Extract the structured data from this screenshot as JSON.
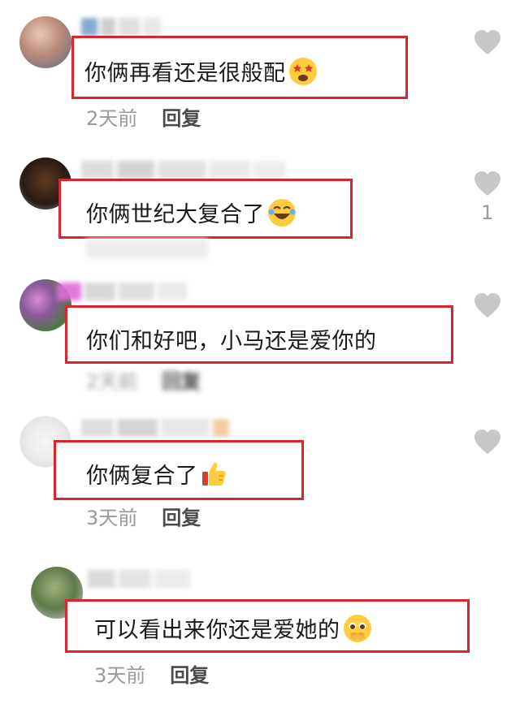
{
  "comments": [
    {
      "text": "你俩再看还是很般配",
      "emoji": "star-eyes-emoji",
      "time": "2天前",
      "reply": "回复",
      "likes": ""
    },
    {
      "text": "你俩世纪大复合了",
      "emoji": "laughing-tears-emoji",
      "time": "",
      "reply": "",
      "likes": "1"
    },
    {
      "text": "你们和好吧，小马还是爱你的",
      "emoji": "",
      "time": "2天前",
      "reply": "回复",
      "likes": ""
    },
    {
      "text": "你俩复合了",
      "emoji": "thumbs-up-emoji",
      "time": "3天前",
      "reply": "回复",
      "likes": ""
    },
    {
      "text": "可以看出来你还是爱她的",
      "emoji": "pleading-face-emoji",
      "time": "3天前",
      "reply": "回复",
      "likes": ""
    }
  ],
  "colors": {
    "highlight_box": "#d8262e",
    "heart": "#c8c8c8",
    "meta": "#9a9a9a"
  }
}
